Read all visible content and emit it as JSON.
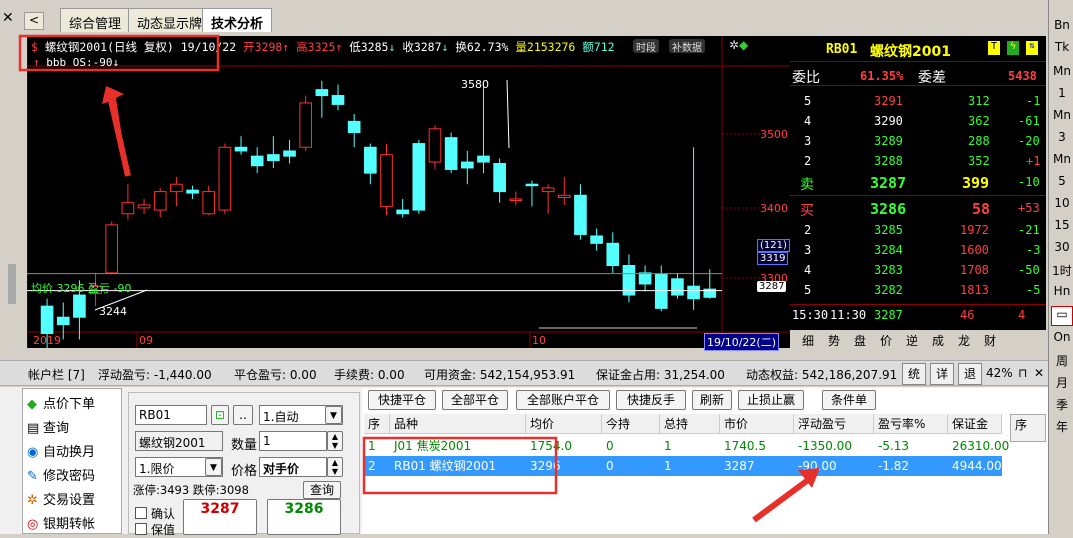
{
  "tabs": {
    "close": "✕",
    "back": "<",
    "items": [
      "综合管理",
      "动态显示牌",
      "技术分析"
    ]
  },
  "chart": {
    "title": "螺纹钢2001(日线 复权) 19/10/22",
    "open": "开3298",
    "high": "高3325",
    "low": "低3285",
    "close": "收3287",
    "turnover": "换62.73%",
    "volume": "量2153276",
    "amount": "额712",
    "btn_time": "时段",
    "btn_fill": "补数据",
    "indicator": "bbb OS:-90",
    "avg_label": "均价 3296 盈亏 -90",
    "price_labels": [
      "3500",
      "3400",
      "3300"
    ],
    "cursor_top": "(121)",
    "cursor_price": "3319",
    "last_price": "3287",
    "annot_high": "3580",
    "annot_low": "3244",
    "x_labels": [
      "2019",
      "09",
      "10"
    ],
    "date_box": "19/10/22(二)",
    "toolbar": [
      "细",
      "势",
      "盘",
      "价",
      "逆",
      "成",
      "龙",
      "财"
    ]
  },
  "chart_data": {
    "type": "candlestick",
    "ohlc": [
      [
        3275,
        3285,
        3210,
        3238
      ],
      [
        3260,
        3280,
        3230,
        3250
      ],
      [
        3290,
        3310,
        3230,
        3260
      ],
      [
        3292,
        3320,
        3275,
        3302
      ],
      [
        3320,
        3390,
        3318,
        3385
      ],
      [
        3400,
        3440,
        3392,
        3415
      ],
      [
        3408,
        3420,
        3400,
        3412
      ],
      [
        3405,
        3435,
        3395,
        3430
      ],
      [
        3430,
        3450,
        3410,
        3440
      ],
      [
        3432,
        3438,
        3420,
        3428
      ],
      [
        3400,
        3438,
        3398,
        3430
      ],
      [
        3405,
        3495,
        3400,
        3490
      ],
      [
        3490,
        3505,
        3480,
        3485
      ],
      [
        3478,
        3490,
        3455,
        3465
      ],
      [
        3480,
        3505,
        3462,
        3472
      ],
      [
        3485,
        3500,
        3468,
        3478
      ],
      [
        3490,
        3560,
        3485,
        3550
      ],
      [
        3568,
        3580,
        3530,
        3560
      ],
      [
        3560,
        3575,
        3540,
        3548
      ],
      [
        3525,
        3535,
        3490,
        3510
      ],
      [
        3490,
        3495,
        3440,
        3455
      ],
      [
        3410,
        3495,
        3398,
        3480
      ],
      [
        3405,
        3420,
        3395,
        3400
      ],
      [
        3495,
        3500,
        3400,
        3405
      ],
      [
        3470,
        3520,
        3460,
        3515
      ],
      [
        3503,
        3510,
        3455,
        3460
      ],
      [
        3470,
        3485,
        3440,
        3462
      ],
      [
        3478,
        3580,
        3455,
        3470
      ],
      [
        3468,
        3475,
        3415,
        3430
      ],
      [
        3418,
        3430,
        3412,
        3420
      ],
      [
        3440,
        3445,
        3410,
        3438
      ],
      [
        3430,
        3440,
        3400,
        3435
      ],
      [
        3422,
        3450,
        3412,
        3425
      ],
      [
        3425,
        3440,
        3365,
        3372
      ],
      [
        3370,
        3380,
        3350,
        3360
      ],
      [
        3360,
        3375,
        3320,
        3330
      ],
      [
        3330,
        3345,
        3280,
        3290
      ],
      [
        3320,
        3330,
        3295,
        3305
      ],
      [
        3318,
        3330,
        3268,
        3272
      ],
      [
        3312,
        3320,
        3285,
        3290
      ],
      [
        3302,
        3490,
        3270,
        3285
      ],
      [
        3298,
        3325,
        3285,
        3287
      ]
    ],
    "ylim": [
      3240,
      3600
    ],
    "avg_line": 3296,
    "cursor_level": 3319
  },
  "quote": {
    "symbol": "RB01",
    "name": "螺纹钢2001",
    "wb_label": "委比",
    "wb_value": "61.35%",
    "wc_label": "委差",
    "wc_value": "5438",
    "asks": [
      [
        "5",
        "3291",
        "312",
        "-1"
      ],
      [
        "4",
        "3290",
        "362",
        "-61"
      ],
      [
        "3",
        "3289",
        "288",
        "-20"
      ],
      [
        "2",
        "3288",
        "352",
        "+1"
      ]
    ],
    "sell": [
      "卖",
      "3287",
      "399",
      "-10"
    ],
    "buy": [
      "买",
      "3286",
      "58",
      "+53"
    ],
    "bids": [
      [
        "2",
        "3285",
        "1972",
        "-21"
      ],
      [
        "3",
        "3284",
        "1600",
        "-3"
      ],
      [
        "4",
        "3283",
        "1708",
        "-50"
      ],
      [
        "5",
        "3282",
        "1813",
        "-5"
      ]
    ],
    "tick": [
      "15:30",
      "11:30",
      "3287",
      "46",
      "4"
    ]
  },
  "rightnav": [
    "Bn",
    "Tk",
    "Mn",
    "1",
    "Mn",
    "3",
    "Mn",
    "5",
    "10",
    "15",
    "30",
    "1时",
    "Hn",
    "周",
    "月",
    "季",
    "年"
  ],
  "acct": {
    "label": "帐户栏 [7]",
    "float_pl": "浮动盈亏: -1,440.00",
    "close_pl": "平仓盈亏: 0.00",
    "fee": "手续费: 0.00",
    "avail": "可用资金: 542,154,953.91",
    "margin": "保证金占用: 31,254.00",
    "equity": "动态权益: 542,186,207.91",
    "btns": [
      "统",
      "详",
      "退"
    ],
    "pct": "42%"
  },
  "menu": [
    "点价下单",
    "查询",
    "自动换月",
    "修改密码",
    "交易设置",
    "银期转帐"
  ],
  "order": {
    "code": "RB01",
    "mode": "1.自动",
    "name": "螺纹钢2001",
    "qty_label": "数量",
    "qty": "1",
    "ptype": "1.限价",
    "price_label": "价格",
    "price": "对手价",
    "limits": "涨停:3493 跌停:3098",
    "query": "查询",
    "confirm": "确认",
    "keep": "保值",
    "buy_price": "3287",
    "sell_price": "3286"
  },
  "grid": {
    "buttons": [
      "快捷平仓",
      "全部平仓",
      "全部账户平仓",
      "快捷反手",
      "刷新",
      "止损止赢",
      "条件单"
    ],
    "headers": [
      "序",
      "品种",
      "均价",
      "今持",
      "总持",
      "市价",
      "浮动盈亏",
      "盈亏率%",
      "保证金"
    ],
    "rows": [
      [
        "1",
        "J01 焦炭2001",
        "1754.0",
        "0",
        "1",
        "1740.5",
        "-1350.00",
        "-5.13",
        "26310.00"
      ],
      [
        "2",
        "RB01 螺纹钢2001",
        "3296",
        "0",
        "1",
        "3287",
        "-90.00",
        "-1.82",
        "4944.00"
      ]
    ],
    "side_header": "序"
  }
}
